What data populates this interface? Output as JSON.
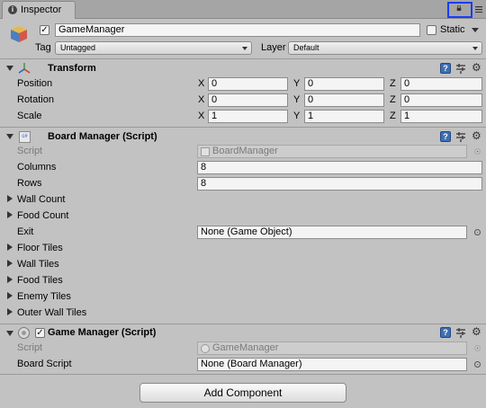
{
  "tab": {
    "title": "Inspector"
  },
  "header": {
    "object_name": "GameManager",
    "active_checked": true,
    "static_label": "Static",
    "tag_label": "Tag",
    "tag_value": "Untagged",
    "layer_label": "Layer",
    "layer_value": "Default"
  },
  "transform": {
    "title": "Transform",
    "rows": [
      {
        "label": "Position",
        "x": "0",
        "y": "0",
        "z": "0"
      },
      {
        "label": "Rotation",
        "x": "0",
        "y": "0",
        "z": "0"
      },
      {
        "label": "Scale",
        "x": "1",
        "y": "1",
        "z": "1"
      }
    ],
    "axes": {
      "x": "X",
      "y": "Y",
      "z": "Z"
    }
  },
  "board_manager": {
    "title": "Board Manager (Script)",
    "script_label": "Script",
    "script_value": "BoardManager",
    "columns_label": "Columns",
    "columns_value": "8",
    "rows_label": "Rows",
    "rows_value": "8",
    "wall_count": "Wall Count",
    "food_count": "Food Count",
    "exit_label": "Exit",
    "exit_value": "None (Game Object)",
    "floor_tiles": "Floor Tiles",
    "wall_tiles": "Wall Tiles",
    "food_tiles": "Food Tiles",
    "enemy_tiles": "Enemy Tiles",
    "outer_wall_tiles": "Outer Wall Tiles"
  },
  "game_manager": {
    "title": "Game Manager (Script)",
    "enabled": true,
    "script_label": "Script",
    "script_value": "GameManager",
    "board_script_label": "Board Script",
    "board_script_value": "None (Board Manager)"
  },
  "add_component_label": "Add Component",
  "colors": {
    "highlight": "#1a3cff",
    "help_blue": "#3d6fb6"
  }
}
